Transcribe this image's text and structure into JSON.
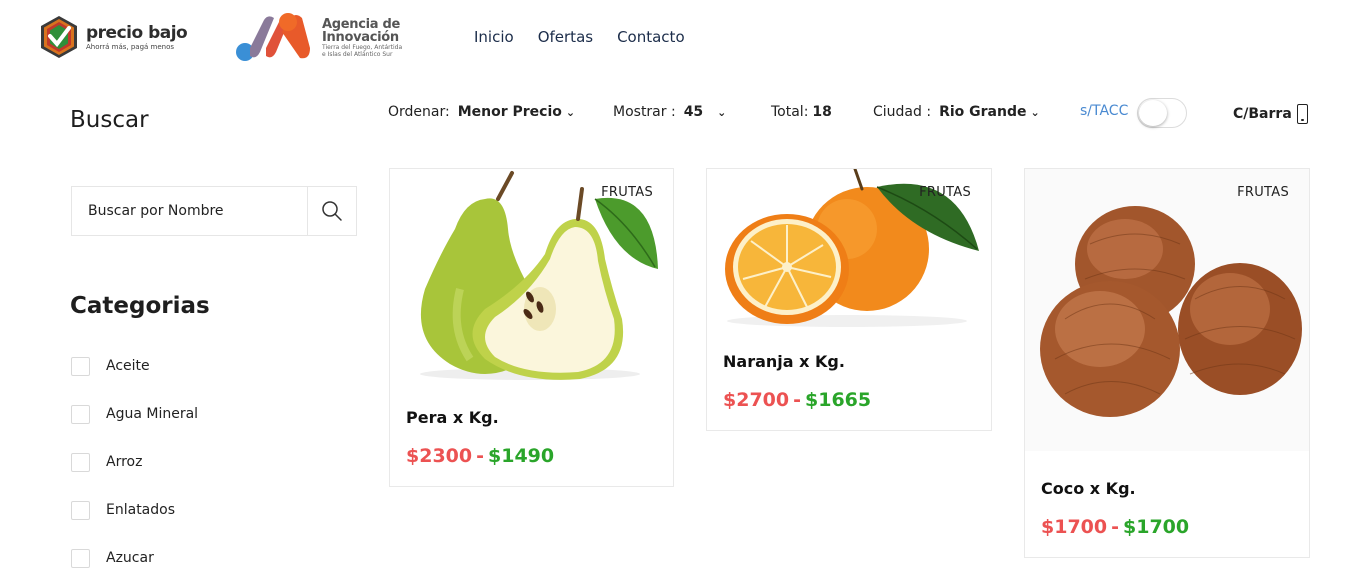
{
  "header": {
    "logo_name": "precio bajo",
    "logo_tagline": "Ahorrá más, pagá menos",
    "agency_title_1": "Agencia de",
    "agency_title_2": "Innovación",
    "agency_sub_1": "Tierra del Fuego, Antártida",
    "agency_sub_2": "e Islas del Atlántico Sur",
    "nav": [
      "Inicio",
      "Ofertas",
      "Contacto"
    ]
  },
  "sidebar": {
    "search_title": "Buscar",
    "search_placeholder": "Buscar por Nombre",
    "categories_title": "Categorias",
    "categories": [
      "Aceite",
      "Agua Mineral",
      "Arroz",
      "Enlatados",
      "Azucar"
    ]
  },
  "toolbar": {
    "sort_label": "Ordenar:",
    "sort_value": "Menor Precio",
    "show_label": "Mostrar :",
    "show_value": "45",
    "total_label": "Total:",
    "total_value": "18",
    "city_label": "Ciudad :",
    "city_value": "Rio Grande",
    "stacc_label": "s/TACC",
    "barcode_label": "C/Barra"
  },
  "products": [
    {
      "category": "FRUTAS",
      "name": "Pera x Kg.",
      "old_price": "$2300",
      "separator": "-",
      "new_price": "$1490",
      "image": "pear-image"
    },
    {
      "category": "FRUTAS",
      "name": "Naranja x Kg.",
      "old_price": "$2700",
      "separator": "-",
      "new_price": "$1665",
      "image": "orange-image"
    },
    {
      "category": "FRUTAS",
      "name": "Coco x Kg.",
      "old_price": "$1700",
      "separator": "-",
      "new_price": "$1700",
      "image": "coconut-image"
    }
  ],
  "colors": {
    "old_price": "#ec5252",
    "new_price": "#2aa52a",
    "nav_text": "#1c2d4a",
    "stacc_label": "#4a8ad1"
  }
}
